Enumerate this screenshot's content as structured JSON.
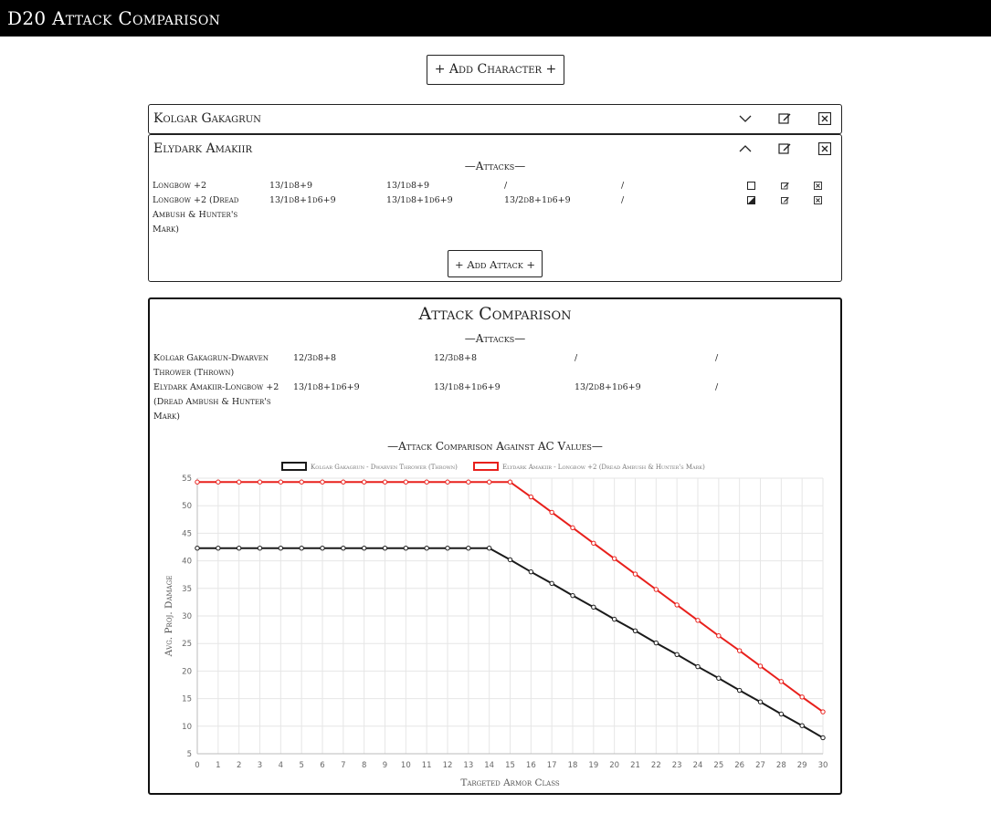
{
  "app_title": "D20 Attack Comparison",
  "add_character_label": "+ Add Character +",
  "characters": [
    {
      "name": "Kolgar Gakagrun",
      "expanded": false
    },
    {
      "name": "Elydark Amakiir",
      "expanded": true,
      "attacks_heading": "—Attacks—",
      "attacks": [
        {
          "name": "Longbow +2",
          "c1": "13/1d8+9",
          "c2": "13/1d8+9",
          "c3": "/",
          "c4": "/",
          "selected": "unchecked"
        },
        {
          "name": "Longbow +2 (Dread Ambush & Hunter's Mark)",
          "c1": "13/1d8+1d6+9",
          "c2": "13/1d8+1d6+9",
          "c3": "13/2d8+1d6+9",
          "c4": "/",
          "selected": "half"
        }
      ],
      "add_attack_label": "+ Add Attack +"
    }
  ],
  "comparison": {
    "title": "Attack Comparison",
    "attacks_heading": "—Attacks—",
    "rows": [
      {
        "name": "Kolgar Gakagrun-Dwarven Thrower (Thrown)",
        "c1": "12/3d8+8",
        "c2": "12/3d8+8",
        "c3": "/",
        "c4": "/"
      },
      {
        "name": "Elydark Amakiir-Longbow +2 (Dread Ambush & Hunter's Mark)",
        "c1": "13/1d8+1d6+9",
        "c2": "13/1d8+1d6+9",
        "c3": "13/2d8+1d6+9",
        "c4": "/"
      }
    ],
    "chart_heading": "—Attack Comparison Against AC Values—"
  },
  "chart_data": {
    "type": "line",
    "xlabel": "Targeted Armor Class",
    "ylabel": "Avg. Proj. Damage",
    "x": [
      0,
      1,
      2,
      3,
      4,
      5,
      6,
      7,
      8,
      9,
      10,
      11,
      12,
      13,
      14,
      15,
      16,
      17,
      18,
      19,
      20,
      21,
      22,
      23,
      24,
      25,
      26,
      27,
      28,
      29,
      30
    ],
    "ylim": [
      5,
      55
    ],
    "yticks": [
      5,
      10,
      15,
      20,
      25,
      30,
      35,
      40,
      45,
      50,
      55
    ],
    "grid": true,
    "legend": "top",
    "series": [
      {
        "name": "Kolgar Gakagrun - Dwarven Thrower (Thrown)",
        "color": "#1a1a1a",
        "values": [
          42.3,
          42.3,
          42.3,
          42.3,
          42.3,
          42.3,
          42.3,
          42.3,
          42.3,
          42.3,
          42.3,
          42.3,
          42.3,
          42.3,
          42.3,
          40.2,
          38.0,
          35.9,
          33.7,
          31.6,
          29.4,
          27.3,
          25.1,
          23.0,
          20.8,
          18.7,
          16.5,
          14.4,
          12.2,
          10.1,
          7.9
        ]
      },
      {
        "name": "Elydark Amakiir - Longbow +2 (Dread Ambush & Hunter's Mark)",
        "color": "#e8201c",
        "values": [
          54.3,
          54.3,
          54.3,
          54.3,
          54.3,
          54.3,
          54.3,
          54.3,
          54.3,
          54.3,
          54.3,
          54.3,
          54.3,
          54.3,
          54.3,
          54.3,
          51.6,
          48.8,
          46.0,
          43.2,
          40.4,
          37.6,
          34.8,
          32.0,
          29.2,
          26.4,
          23.7,
          20.9,
          18.1,
          15.3,
          12.6
        ]
      }
    ]
  },
  "icons": {
    "collapse": "chevron-down-icon",
    "expand": "chevron-up-icon",
    "edit": "edit-icon",
    "delete": "close-box-icon"
  }
}
